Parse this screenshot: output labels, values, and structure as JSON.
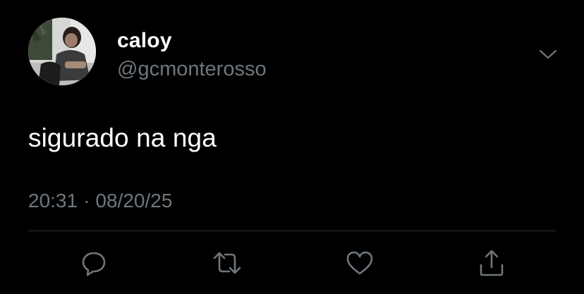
{
  "tweet": {
    "display_name": "caloy",
    "handle": "@gcmonterosso",
    "text": "sigurado na nga",
    "time": "20:31",
    "separator": "·",
    "date": "08/20/25"
  },
  "icons": {
    "menu": "chevron-down-icon",
    "reply": "reply-icon",
    "retweet": "retweet-icon",
    "like": "heart-icon",
    "share": "share-icon"
  },
  "colors": {
    "background": "#000000",
    "text_primary": "#ffffff",
    "text_secondary": "#6e767d",
    "divider": "#2f3336"
  }
}
